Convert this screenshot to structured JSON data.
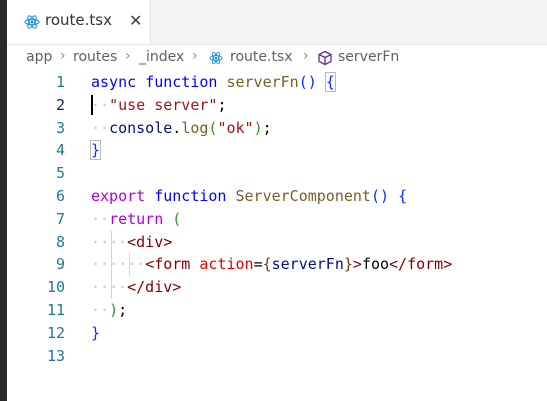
{
  "tab": {
    "label": "route.tsx",
    "close": "✕"
  },
  "breadcrumb": {
    "items": [
      "app",
      "routes",
      "_index",
      "route.tsx",
      "serverFn"
    ]
  },
  "line_numbers": [
    "1",
    "2",
    "3",
    "4",
    "5",
    "6",
    "7",
    "8",
    "9",
    "10",
    "11",
    "12",
    "13"
  ],
  "code": {
    "l1": {
      "kw": "async",
      "kw2": "function",
      "fn": "serverFn",
      "paren": "()",
      "brace": "{"
    },
    "l2": {
      "str": "\"use server\"",
      "semi": ";"
    },
    "l3": {
      "obj": "console",
      "dot": ".",
      "fn": "log",
      "po": "(",
      "str": "\"ok\"",
      "pc": ")",
      "semi": ";"
    },
    "l4": {
      "brace": "}"
    },
    "l6": {
      "kw2": "export",
      "kw": "function",
      "fn": "ServerComponent",
      "paren": "()",
      "brace": "{"
    },
    "l7": {
      "kw2": "return",
      "paren": "("
    },
    "l8": {
      "tag": "<div>"
    },
    "l9": {
      "open": "<form",
      "attr": "action",
      "eq": "=",
      "bo": "{",
      "var": "serverFn",
      "bc": "}",
      "gt": ">",
      "text": "foo",
      "close": "</form>"
    },
    "l10": {
      "tag": "</div>"
    },
    "l11": {
      "paren": ")",
      "semi": ";"
    },
    "l12": {
      "brace": "}"
    }
  },
  "colors": {
    "keyword": "#0000ff",
    "control": "#af00db",
    "function": "#795e26",
    "string": "#a31515",
    "tag": "#800000",
    "attribute": "#e50000",
    "line_number": "#237893"
  },
  "icons": {
    "tab_icon": "react-icon",
    "symbol_icon": "function-cube-icon",
    "separator": "chevron-right-icon"
  }
}
